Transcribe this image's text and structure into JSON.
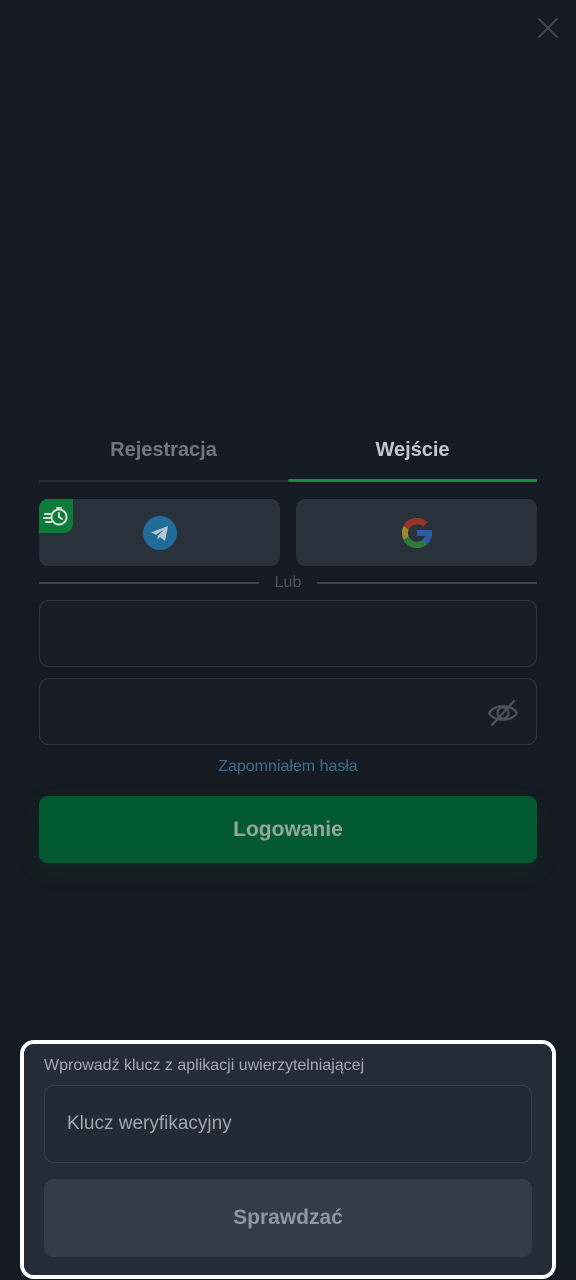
{
  "tabs": [
    {
      "label": "Rejestracja",
      "active": false
    },
    {
      "label": "Wejście",
      "active": true
    }
  ],
  "social": {
    "telegram_icon": "telegram-icon",
    "google_icon": "google-icon",
    "speed_badge_icon": "fast-timer-icon"
  },
  "divider": {
    "text": "Lub"
  },
  "login_form": {
    "login_value": "",
    "password_value": "",
    "password_toggle_icon": "eye-off-icon",
    "forgot_label": "Zapomniałem hasła",
    "submit_label": "Logowanie"
  },
  "verification": {
    "title": "Wprowadź klucz z aplikacji uwierzytelniającej",
    "placeholder": "Klucz weryfikacyjny",
    "value": "",
    "submit_label": "Sprawdzać"
  },
  "colors": {
    "background": "#151b22",
    "accent_green": "#045a30",
    "tab_underline": "#138a40",
    "link": "#3d6e8c",
    "highlight_border": "#ffffff"
  }
}
